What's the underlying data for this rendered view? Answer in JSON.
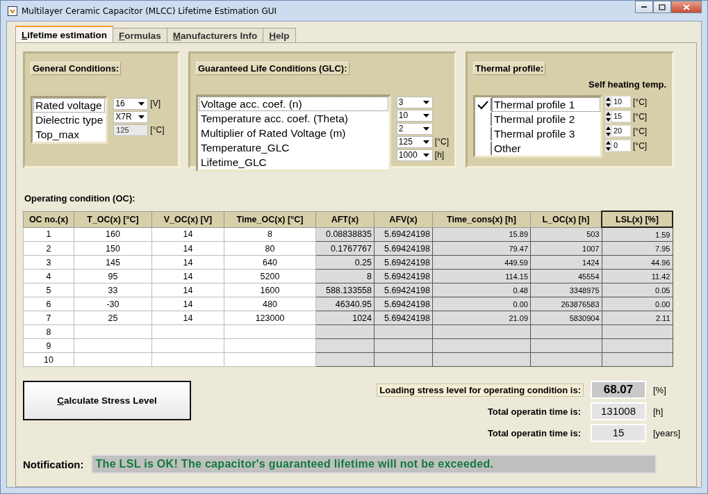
{
  "window": {
    "title": "Multilayer Ceramic Capacitor (MLCC) Lifetime Estimation GUI"
  },
  "tabs": [
    {
      "label": "Lifetime estimation",
      "selected": true
    },
    {
      "label": "Formulas",
      "selected": false
    },
    {
      "label": "Manufacturers Info",
      "selected": false
    },
    {
      "label": "Help",
      "selected": false
    }
  ],
  "general_conditions": {
    "title": "General Conditions:",
    "items": [
      {
        "label": "Rated voltage",
        "focused": true,
        "control": {
          "kind": "dropdown",
          "value": "16",
          "unit": "[V]"
        }
      },
      {
        "label": "Dielectric type",
        "focused": false,
        "control": {
          "kind": "dropdown",
          "value": "X7R"
        }
      },
      {
        "label": "Top_max",
        "focused": false,
        "control": {
          "kind": "field",
          "value": "125",
          "disabled": true,
          "unit": "[°C]"
        }
      }
    ]
  },
  "glc": {
    "title": "Guaranteed Life Conditions (GLC):",
    "items": [
      {
        "label": "Voltage acc. coef. (n)",
        "focused": true,
        "control": {
          "kind": "dropdown",
          "value": "3"
        }
      },
      {
        "label": "Temperature acc. coef. (Theta)",
        "focused": false,
        "control": {
          "kind": "dropdown",
          "value": "10"
        }
      },
      {
        "label": "Multiplier of Rated Voltage (m)",
        "focused": false,
        "control": {
          "kind": "dropdown",
          "value": "2"
        }
      },
      {
        "label": "Temperature_GLC",
        "focused": false,
        "control": {
          "kind": "dropdown",
          "value": "125",
          "unit": "[°C]"
        }
      },
      {
        "label": "Lifetime_GLC",
        "focused": false,
        "control": {
          "kind": "dropdown",
          "value": "1000",
          "unit": "[h]"
        }
      }
    ]
  },
  "thermal_profile": {
    "title": "Thermal profile:",
    "column_heading": "Self heating temp.",
    "items": [
      {
        "label": "Thermal profile 1",
        "checked": true,
        "focused": true,
        "control": {
          "kind": "spinner",
          "value": "10",
          "unit": "[°C]"
        }
      },
      {
        "label": "Thermal profile 2",
        "checked": false,
        "focused": false,
        "control": {
          "kind": "spinner",
          "value": "15",
          "unit": "[°C]"
        }
      },
      {
        "label": "Thermal profile 3",
        "checked": false,
        "focused": false,
        "control": {
          "kind": "spinner",
          "value": "20",
          "unit": "[°C]"
        }
      },
      {
        "label": "Other",
        "checked": false,
        "focused": false,
        "control": {
          "kind": "spinner",
          "value": "0",
          "unit": "[°C]"
        }
      }
    ]
  },
  "operating_condition": {
    "title": "Operating condition (OC):",
    "table": {
      "columns": [
        {
          "label": "OC no.(x)",
          "kind": "input",
          "selected": false
        },
        {
          "label": "T_OC(x) [°C]",
          "kind": "input",
          "selected": false
        },
        {
          "label": "V_OC(x) [V]",
          "kind": "input",
          "selected": false
        },
        {
          "label": "Time_OC(x) [°C]",
          "kind": "input",
          "selected": false
        },
        {
          "label": "AFT(x)",
          "kind": "result",
          "selected": false
        },
        {
          "label": "AFV(x)",
          "kind": "result",
          "selected": false
        },
        {
          "label": "Time_cons(x) [h]",
          "kind": "small",
          "selected": false
        },
        {
          "label": "L_OC(x) [h]",
          "kind": "small",
          "selected": false
        },
        {
          "label": "LSL(x) [%]",
          "kind": "small",
          "selected": true
        }
      ],
      "rows": [
        [
          "1",
          "160",
          "14",
          "8",
          "0.08838835",
          "5.69424198",
          "15.89",
          "503",
          "1.59"
        ],
        [
          "2",
          "150",
          "14",
          "80",
          "0.1767767",
          "5.69424198",
          "79.47",
          "1007",
          "7.95"
        ],
        [
          "3",
          "145",
          "14",
          "640",
          "0.25",
          "5.69424198",
          "449.59",
          "1424",
          "44.96"
        ],
        [
          "4",
          "95",
          "14",
          "5200",
          "8",
          "5.69424198",
          "114.15",
          "45554",
          "11.42"
        ],
        [
          "5",
          "33",
          "14",
          "1600",
          "588.133558",
          "5.69424198",
          "0.48",
          "3348975",
          "0.05"
        ],
        [
          "6",
          "-30",
          "14",
          "480",
          "46340.95",
          "5.69424198",
          "0.00",
          "263876583",
          "0.00"
        ],
        [
          "7",
          "25",
          "14",
          "123000",
          "1024",
          "5.69424198",
          "21.09",
          "5830904",
          "2.11"
        ],
        [
          "8"
        ],
        [
          "9"
        ],
        [
          "10"
        ]
      ]
    }
  },
  "calculate_button": "Calculate Stress Level",
  "results": [
    {
      "label": "Loading stress level for operating condition is:",
      "value": "68.07",
      "unit": "[%]",
      "highlighted": true
    },
    {
      "label": "Total operatin time is:",
      "value": "131008",
      "unit": "[h]",
      "highlighted": false
    },
    {
      "label": "Total operatin time is:",
      "value": "15",
      "unit": "[years]",
      "highlighted": false
    }
  ],
  "notification": {
    "label": "Notification:",
    "message": "The LSL is OK! The capacitor's guaranteed lifetime will not be exceeded."
  }
}
